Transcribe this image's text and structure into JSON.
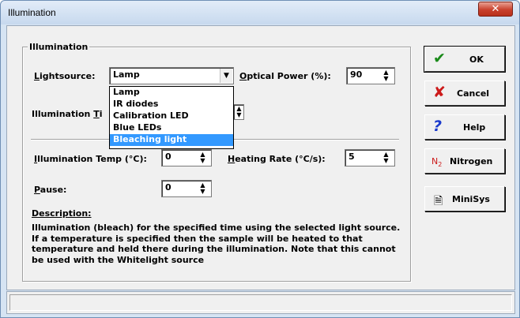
{
  "window": {
    "title": "Illumination",
    "close_glyph": "✕"
  },
  "group": {
    "title": "Illumination"
  },
  "lightsource": {
    "label_underlined": "L",
    "label_rest": "ightsource:",
    "value": "Lamp",
    "options": [
      "Lamp",
      "IR diodes",
      "Calibration LED",
      "Blue LEDs",
      "Bleaching light"
    ],
    "highlighted": "Bleaching light"
  },
  "optical_power": {
    "label_underlined": "O",
    "label_rest": "ptical Power (%):",
    "value": "90"
  },
  "illumination_time": {
    "label_prefix": "Illumination ",
    "label_underlined": "T",
    "label_rest": "i"
  },
  "illumination_temp": {
    "label_underlined": "I",
    "label_rest": "llumination Temp (°C):",
    "value": "0"
  },
  "heating_rate": {
    "label_underlined": "H",
    "label_rest": "eating Rate (°C/s):",
    "value": "5"
  },
  "pause": {
    "label_underlined": "P",
    "label_rest": "ause:",
    "value": "0"
  },
  "description": {
    "heading": "Description:",
    "text": "Illumination (bleach) for the specified time using the selected light source. If a temperature is specified then the sample will be heated to that temperature and held there during the illumination. Note that this cannot be used with the Whitelight source"
  },
  "buttons": {
    "ok": "OK",
    "cancel": "Cancel",
    "help": "Help",
    "nitrogen": "Nitrogen",
    "minisys": "MiniSys"
  },
  "colors": {
    "ok_icon": "#1a8a1a",
    "cancel_icon": "#cc1a1a",
    "help_icon": "#1a3acc",
    "nitrogen_icon": "#cc1a1a",
    "selection": "#3399ff"
  }
}
